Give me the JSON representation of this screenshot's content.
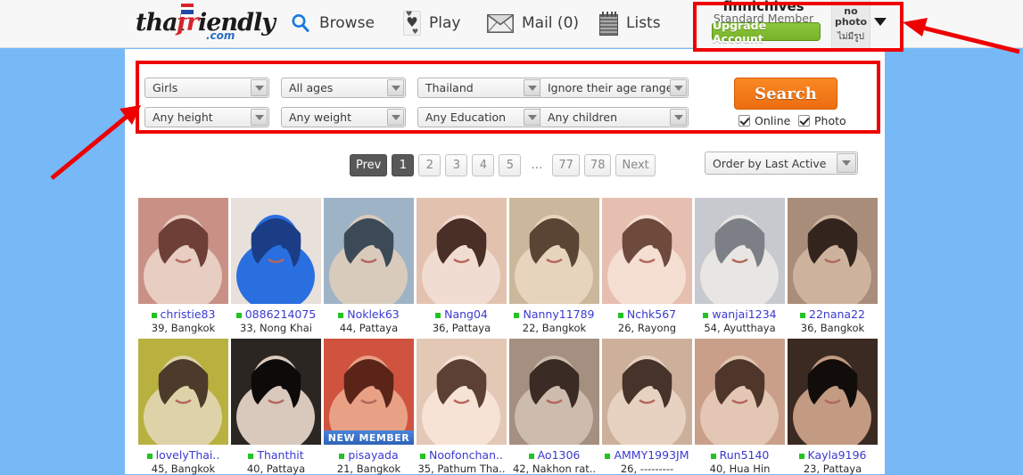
{
  "site": {
    "logo_thai": "thai",
    "logo_fr": "fr",
    "logo_iendly": "iendly",
    "logo_com": ".com"
  },
  "nav": [
    {
      "label": "Browse",
      "icon": "search-icon"
    },
    {
      "label": "Play",
      "icon": "playing-card-heart-icon"
    },
    {
      "label": "Mail (0)",
      "icon": "envelope-icon"
    },
    {
      "label": "Lists",
      "icon": "notepad-icon"
    }
  ],
  "member": {
    "username": "finnichives",
    "status": "Standard Member",
    "upgrade_label": "Upgrade Account",
    "avatar_line1": "no",
    "avatar_line2": "photo",
    "avatar_thai": "ไม่มีรูป"
  },
  "search": {
    "filters_row1": [
      {
        "name": "gender",
        "value": "Girls"
      },
      {
        "name": "age",
        "value": "All ages"
      },
      {
        "name": "country",
        "value": "Thailand"
      },
      {
        "name": "age-range",
        "value": "Ignore their age range"
      }
    ],
    "filters_row2": [
      {
        "name": "height",
        "value": "Any height"
      },
      {
        "name": "weight",
        "value": "Any weight"
      },
      {
        "name": "education",
        "value": "Any Education"
      },
      {
        "name": "children",
        "value": "Any children"
      }
    ],
    "search_button": "Search",
    "checkboxes": [
      {
        "label": "Online",
        "checked": true
      },
      {
        "label": "Photo",
        "checked": true
      }
    ]
  },
  "pagination": {
    "prev": "Prev",
    "pages": [
      "1",
      "2",
      "3",
      "4",
      "5",
      "…",
      "77",
      "78"
    ],
    "active": "1",
    "next": "Next"
  },
  "sort": {
    "value": "Order by Last Active"
  },
  "results": {
    "row1": [
      {
        "name": "christie83",
        "meta": "39, Bangkok",
        "online": true,
        "new": false,
        "c1": "#c99186",
        "c2": "#6e3f37",
        "c3": "#e8cdc2"
      },
      {
        "name": "0886214075",
        "meta": "33, Nong Khai",
        "online": true,
        "new": false,
        "c1": "#e8e0da",
        "c2": "#1a3d86",
        "c3": "#2a6fe0"
      },
      {
        "name": "Noklek63",
        "meta": "44, Pattaya",
        "online": true,
        "new": false,
        "c1": "#9fb3c6",
        "c2": "#3c4a58",
        "c3": "#d8cbbb"
      },
      {
        "name": "Nang04",
        "meta": "36, Pattaya",
        "online": true,
        "new": false,
        "c1": "#e2c2ae",
        "c2": "#4a2f26",
        "c3": "#f0dcd0"
      },
      {
        "name": "Nanny11789",
        "meta": "22, Bangkok",
        "online": true,
        "new": false,
        "c1": "#cbb79b",
        "c2": "#5a4433",
        "c3": "#e6d4bd"
      },
      {
        "name": "Nchk567",
        "meta": "26, Rayong",
        "online": true,
        "new": false,
        "c1": "#e7bfb0",
        "c2": "#6d4a3c",
        "c3": "#f5ded2"
      },
      {
        "name": "wanjai1234",
        "meta": "54, Ayutthaya",
        "online": true,
        "new": false,
        "c1": "#c7c9cf",
        "c2": "#7d7f87",
        "c3": "#e8e6e2"
      },
      {
        "name": "22nana22",
        "meta": "36, Bangkok",
        "online": true,
        "new": false,
        "c1": "#a98d7b",
        "c2": "#33251d",
        "c3": "#cdb39e"
      }
    ],
    "row2": [
      {
        "name": "lovelyThai..",
        "meta": "45, Bangkok",
        "online": true,
        "new": false,
        "c1": "#b9b13f",
        "c2": "#4c3b2b",
        "c3": "#ded3a8"
      },
      {
        "name": "Thanthit",
        "meta": "40, Pattaya",
        "online": true,
        "new": false,
        "c1": "#2c2622",
        "c2": "#0d0b0a",
        "c3": "#d9c9bc"
      },
      {
        "name": "pisayada",
        "meta": "21, Bangkok",
        "online": true,
        "new": true,
        "c1": "#d0533f",
        "c2": "#5b2418",
        "c3": "#e8a184"
      },
      {
        "name": "Noofonchan..",
        "meta": "35, Pathum Tha..",
        "online": true,
        "new": false,
        "c1": "#e4c8b6",
        "c2": "#5d4034",
        "c3": "#f6e3d6"
      },
      {
        "name": "Ao1306",
        "meta": "42, Nakhon rat..",
        "online": true,
        "new": false,
        "c1": "#a48f80",
        "c2": "#3a2c24",
        "c3": "#cdbbad"
      },
      {
        "name": "AMMY1993JM",
        "meta": "26, ---------",
        "online": true,
        "new": false,
        "c1": "#cdb09b",
        "c2": "#46332a",
        "c3": "#e7d2c1"
      },
      {
        "name": "Run5140",
        "meta": "40, Hua Hin",
        "online": true,
        "new": false,
        "c1": "#c99f8a",
        "c2": "#4e362b",
        "c3": "#e3c7b4"
      },
      {
        "name": "Kayla9196",
        "meta": "23, Pattaya",
        "online": true,
        "new": false,
        "c1": "#3b2a22",
        "c2": "#120d0b",
        "c3": "#c39a82"
      }
    ],
    "new_badge_label": "NEW MEMBER"
  },
  "annotations": {
    "highlight_color": "#ee0000",
    "boxes": [
      "member-area-highlight",
      "search-filters-highlight"
    ],
    "arrows": [
      "arrow-to-member-area",
      "arrow-to-search-filters"
    ]
  },
  "colors": {
    "page_background": "#77b8f7",
    "header_background": "#f7f7f7",
    "content_background": "#ffffff",
    "accent_orange": "#ed6d10",
    "accent_green": "#8cc63e",
    "link_blue": "#3a3ad0",
    "online_green": "#22c322"
  }
}
